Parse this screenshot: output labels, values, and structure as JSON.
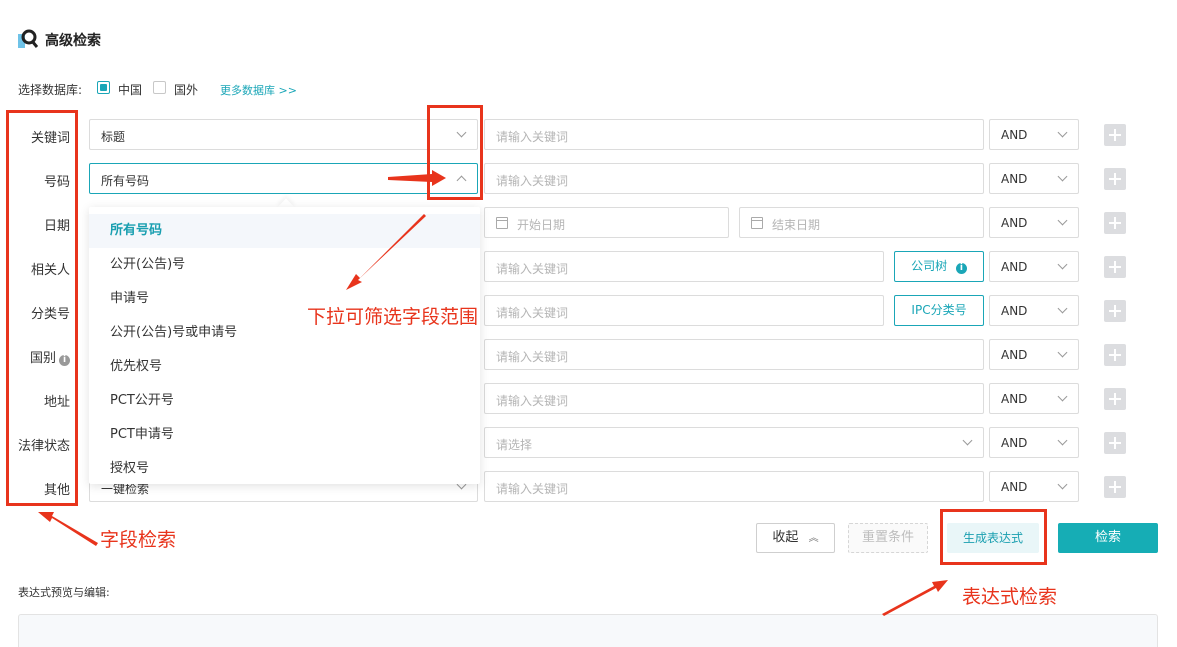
{
  "header": {
    "title": "高级检索",
    "logo_icon": "search-logo-icon"
  },
  "database": {
    "label": "选择数据库:",
    "options": [
      {
        "label": "中国",
        "checked": true
      },
      {
        "label": "国外",
        "checked": false
      }
    ],
    "more_link": "更多数据库 >>"
  },
  "rows": [
    {
      "label": "关键词",
      "field": "标题",
      "placeholder": "请输入关键词",
      "operator": "AND"
    },
    {
      "label": "号码",
      "field": "所有号码",
      "placeholder": "请输入关键词",
      "operator": "AND"
    },
    {
      "label": "日期",
      "start_placeholder": "开始日期",
      "end_placeholder": "结束日期",
      "operator": "AND"
    },
    {
      "label": "相关人",
      "placeholder": "请输入关键词",
      "button": "公司树",
      "operator": "AND"
    },
    {
      "label": "分类号",
      "placeholder": "请输入关键词",
      "button": "IPC分类号",
      "operator": "AND"
    },
    {
      "label": "国别",
      "placeholder": "请输入关键词",
      "operator": "AND"
    },
    {
      "label": "地址",
      "placeholder": "请输入关键词",
      "operator": "AND"
    },
    {
      "label": "法律状态",
      "placeholder": "请选择",
      "operator": "AND"
    },
    {
      "label": "其他",
      "field": "一键检索",
      "placeholder": "请输入关键词",
      "operator": "AND"
    }
  ],
  "dropdown": {
    "items": [
      "所有号码",
      "公开(公告)号",
      "申请号",
      "公开(公告)号或申请号",
      "优先权号",
      "PCT公开号",
      "PCT申请号",
      "授权号"
    ],
    "selected_index": 0
  },
  "actions": {
    "collapse": "收起",
    "reset": "重置条件",
    "generate": "生成表达式",
    "search": "检索"
  },
  "expression": {
    "label": "表达式预览与编辑:"
  },
  "annotations": {
    "dropdown_note": "下拉可筛选字段范围",
    "field_note": "字段检索",
    "expression_note": "表达式检索",
    "accent_color": "#e8341c"
  },
  "colors": {
    "brand": "#16adb5",
    "text": "#333333"
  }
}
